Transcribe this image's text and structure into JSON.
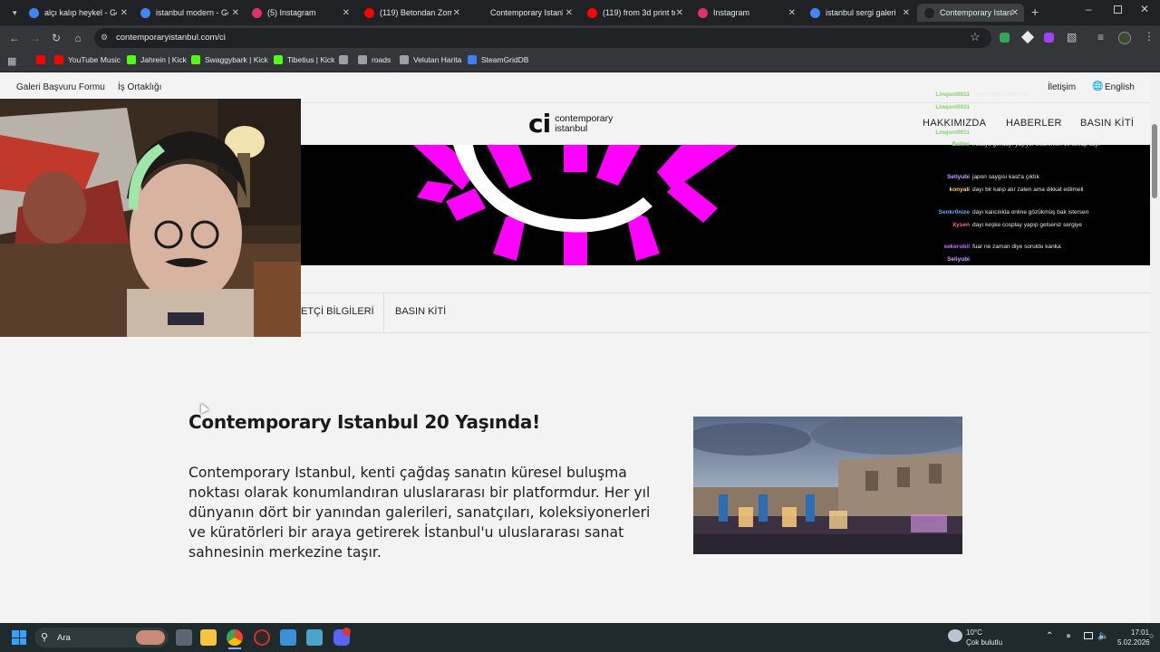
{
  "browser": {
    "tabs": [
      {
        "label": "alçı kalıp heykel - Go",
        "color": "#4285f4"
      },
      {
        "label": "istanbul modern - Go",
        "color": "#4285f4"
      },
      {
        "label": "(5) Instagram",
        "color": "#e1306c"
      },
      {
        "label": "(119) Betondan Zomb",
        "color": "#ff0000"
      },
      {
        "label": "Contemporary Istanb",
        "color": "#202124"
      },
      {
        "label": "(119) from 3d print to",
        "color": "#ff0000"
      },
      {
        "label": "Instagram",
        "color": "#e1306c"
      },
      {
        "label": "istanbul sergi galeri c",
        "color": "#4285f4"
      },
      {
        "label": "Contemporary Istanb",
        "color": "#202124"
      }
    ],
    "url": "contemporaryistanbul.com/ci",
    "bookmarks": [
      {
        "label": "",
        "color": "#ff0000"
      },
      {
        "label": "YouTube Music",
        "color": "#ff0000"
      },
      {
        "label": "Jahrein | Kick",
        "color": "#53fc18"
      },
      {
        "label": "Swaggybark | Kick",
        "color": "#53fc18"
      },
      {
        "label": "Tibetius | Kick",
        "color": "#53fc18"
      },
      {
        "label": "",
        "color": "#9aa0a6"
      },
      {
        "label": "roads",
        "color": "#9aa0a6"
      },
      {
        "label": "Velutan Harita",
        "color": "#9aa0a6"
      },
      {
        "label": "SteamGridDB",
        "color": "#3f7fff"
      }
    ]
  },
  "site": {
    "topnav": {
      "left": [
        "Galeri Başvuru Formu",
        "İş Ortaklığı"
      ],
      "right_contact": "İletişim",
      "language": "English"
    },
    "logo": {
      "mark": "ci",
      "line1": "contemporary",
      "line2": "istanbul"
    },
    "mainnav": [
      "HAKKIMIZDA",
      "HABERLER",
      "BASIN KİTİ"
    ],
    "subnav": [
      "ETÇİ BİLGİLERİ",
      "BASIN KİTİ"
    ],
    "title": "Contemporary Istanbul 20 Yaşında!",
    "paragraph": "Contemporary Istanbul, kenti çağdaş sanatın küresel buluşma noktası olarak konumlandıran uluslararası bir platformdur. Her yıl dünyanın dört bir yanından galerileri, sanatçıları, koleksiyonerleri ve küratörleri bir araya getirerek İstanbul'u uluslararası sanat sahnesinin merkezine taşır."
  },
  "chat": [
    {
      "user": "Linqoni0011",
      "msg": "Linqo bağla chatı fire",
      "ucolor": "#7fd36c"
    },
    {
      "user": "Linqoni0011",
      "msg": "",
      "ucolor": "#7fd36c"
    },
    {
      "user": "Linqoni0011",
      "msg": "",
      "ucolor": "#7fd36c"
    },
    {
      "user": "Ballini",
      "msg": "instaya gel dayı yaşıyor bildirimleri ve cevap sayıcı",
      "ucolor": "#7fd36c"
    },
    {
      "user": "Seliyubi",
      "msg": "japon saygısı kast'a çıktık",
      "ucolor": "#c8a2ff"
    },
    {
      "user": "konyali",
      "msg": "dayı bir kalıp alır zaten ama dikkat edilmeli",
      "ucolor": "#ffd27f"
    },
    {
      "user": "Senkr0nize",
      "msg": "dayı kalıcılıkla online gözükmüş bak istersen",
      "ucolor": "#6fa8ff"
    },
    {
      "user": "Xysen",
      "msg": "dayı keşke cosplay yapıp gelseniz sergiye",
      "ucolor": "#ff6f6f"
    },
    {
      "user": "sekerobil",
      "msg": "fuar ne zaman diye soruldu kanka",
      "ucolor": "#d36cff"
    },
    {
      "user": "Seliyubi",
      "msg": "",
      "ucolor": "#c8a2ff"
    }
  ],
  "taskbar": {
    "search_placeholder": "Ara",
    "weather_temp": "10°C",
    "weather_desc": "Çok bulutlu",
    "time": "17:01",
    "date": "5.02.2026"
  }
}
